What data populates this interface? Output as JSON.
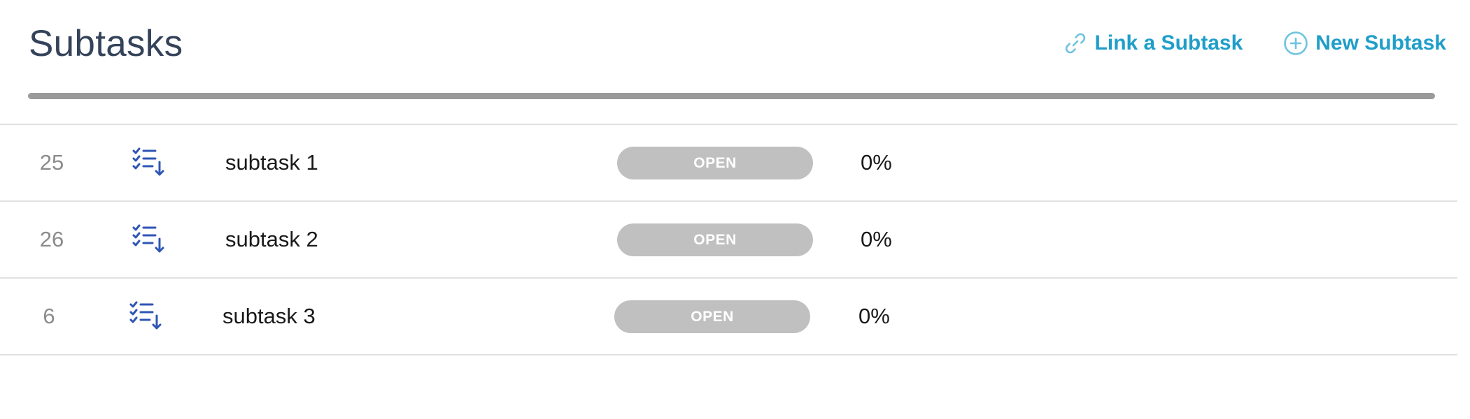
{
  "header": {
    "title": "Subtasks",
    "link_subtask_label": "Link a Subtask",
    "new_subtask_label": "New Subtask",
    "link_icon": "link-icon",
    "new_icon": "plus-circle-icon"
  },
  "colors": {
    "title": "#34435a",
    "accent": "#1f9ec9",
    "task_icon": "#2f55b5",
    "badge_bg": "#c0c0c0",
    "divider": "#9a9a9a"
  },
  "subtasks": [
    {
      "id": "25",
      "icon": "subtask-list-icon",
      "name": "subtask 1",
      "status": "OPEN",
      "progress": "0%"
    },
    {
      "id": "26",
      "icon": "subtask-list-icon",
      "name": "subtask 2",
      "status": "OPEN",
      "progress": "0%"
    },
    {
      "id": "6",
      "icon": "subtask-list-icon",
      "name": "subtask 3",
      "status": "OPEN",
      "progress": "0%"
    }
  ]
}
